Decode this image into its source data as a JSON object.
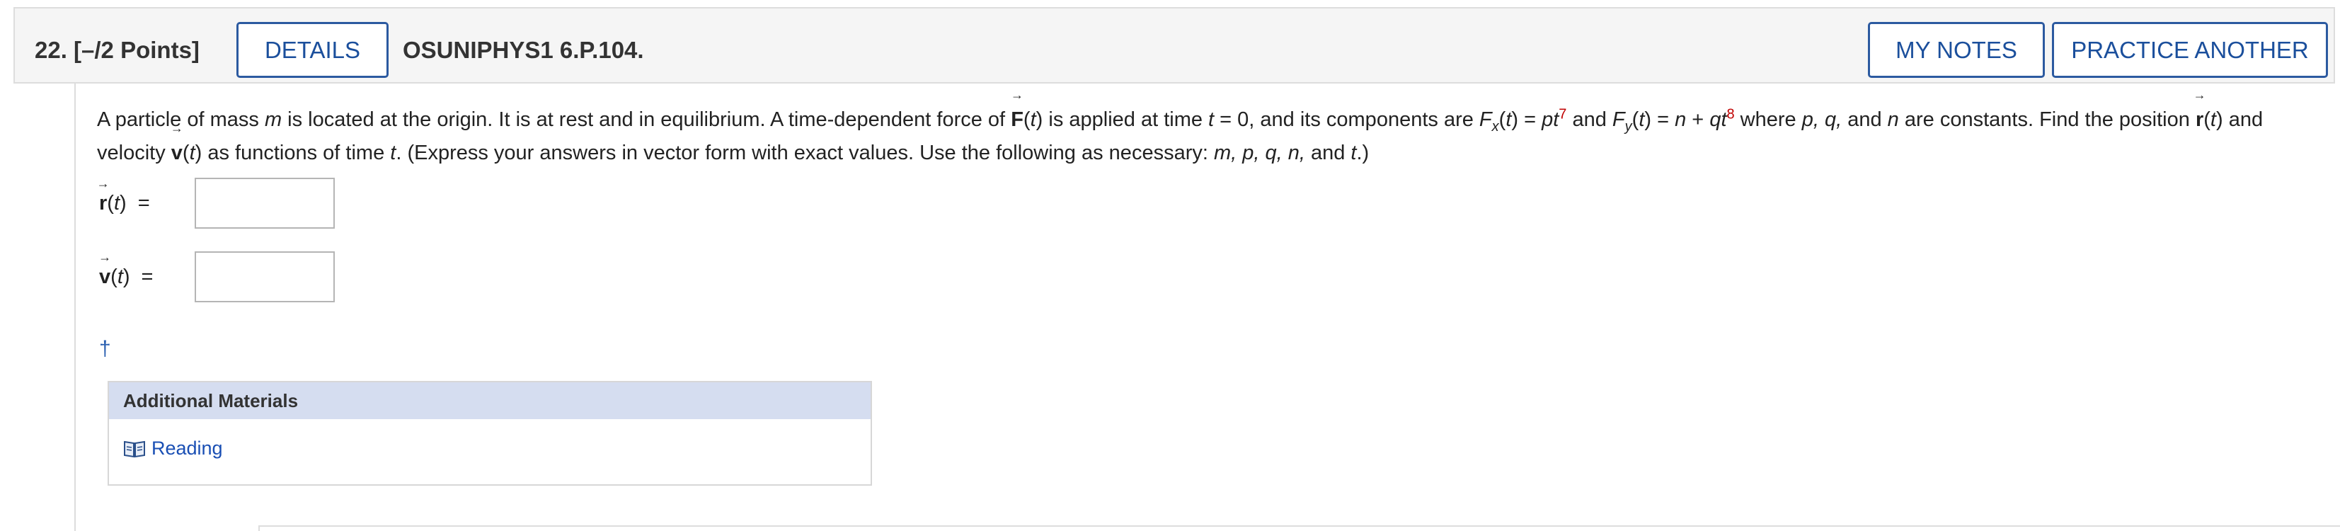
{
  "header": {
    "question_number": "22.",
    "points": "[–/2 Points]",
    "details_label": "DETAILS",
    "question_code": "OSUNIPHYS1 6.P.104.",
    "my_notes_label": "MY NOTES",
    "practice_label": "PRACTICE ANOTHER"
  },
  "problem": {
    "t1": "A particle of mass ",
    "m": "m",
    "t2": " is located at the origin. It is at rest and in equilibrium. A time-dependent force of ",
    "F": "F",
    "t": "t",
    "t3": " is applied at time ",
    "t4": " = 0, and its components are ",
    "Fx": "F",
    "x": "x",
    "t5": " = ",
    "pt": "pt",
    "exp7": "7",
    "t6": " and ",
    "Fy": "F",
    "y": "y",
    "t7": " = ",
    "n": "n",
    "t8": " + ",
    "qt": "qt",
    "exp8": "8",
    "t9": " where ",
    "vars_pqn": "p, q,",
    "t10": " and ",
    "t11": " are constants. Find the position ",
    "r": "r",
    "t12": " and velocity ",
    "v": "v",
    "t13": " as functions of time ",
    "t14": ". (Express your answers in vector form with exact values. Use the following as necessary: ",
    "list": "m, p, q, n,",
    "t15": " and ",
    "t16": ".)"
  },
  "answers": [
    {
      "vec": "r",
      "arg": "t",
      "eq": "="
    },
    {
      "vec": "v",
      "arg": "t",
      "eq": "="
    }
  ],
  "dagger": "†",
  "additional_materials": {
    "title": "Additional Materials",
    "items": [
      {
        "label": "Reading",
        "icon": "book-icon"
      }
    ]
  },
  "colors": {
    "link": "#1a4fb4",
    "button_border": "#2c5aa0",
    "exponent": "#c00000",
    "materials_header_bg": "#d5ddf0"
  }
}
